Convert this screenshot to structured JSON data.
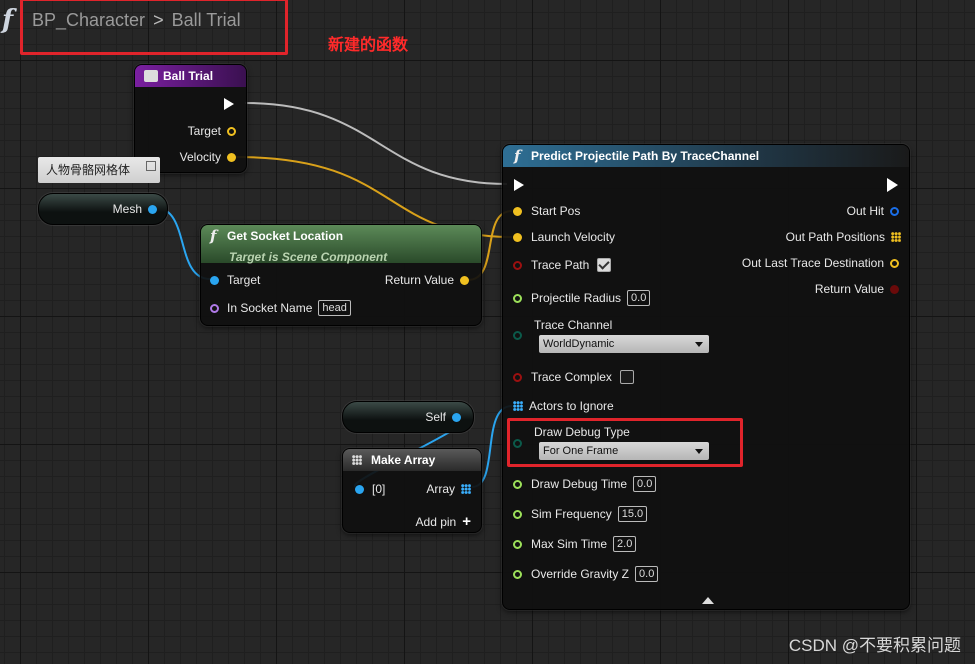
{
  "breadcrumb": {
    "icon": "function-icon",
    "graph": "BP_Character",
    "separator": ">",
    "function": "Ball Trial"
  },
  "annotation": "新建的函数",
  "tooltip": "人物骨骼网格体",
  "nodes": {
    "ball_trial": {
      "title": "Ball Trial",
      "pins": {
        "target": "Target",
        "velocity": "Velocity"
      }
    },
    "mesh_var": {
      "label": "Mesh"
    },
    "get_socket": {
      "title": "Get Socket Location",
      "subtitle": "Target is Scene Component",
      "pins": {
        "target": "Target",
        "socket_name": "In Socket Name",
        "socket_value": "head",
        "return_value": "Return Value"
      }
    },
    "self_var": {
      "label": "Self"
    },
    "make_array": {
      "title": "Make Array",
      "pins": {
        "index0": "[0]",
        "array": "Array",
        "add_pin": "Add pin"
      }
    },
    "predict": {
      "title": "Predict Projectile Path By TraceChannel",
      "inputs": {
        "start_pos": "Start Pos",
        "launch_velocity": "Launch Velocity",
        "trace_path": "Trace Path",
        "projectile_radius": "Projectile Radius",
        "projectile_radius_value": "0.0",
        "trace_channel": "Trace Channel",
        "trace_channel_value": "WorldDynamic",
        "trace_complex": "Trace Complex",
        "actors_to_ignore": "Actors to Ignore",
        "draw_debug_type": "Draw Debug Type",
        "draw_debug_type_value": "For One Frame",
        "draw_debug_time": "Draw Debug Time",
        "draw_debug_time_value": "0.0",
        "sim_frequency": "Sim Frequency",
        "sim_frequency_value": "15.0",
        "max_sim_time": "Max Sim Time",
        "max_sim_time_value": "2.0",
        "override_gravity": "Override Gravity Z",
        "override_gravity_value": "0.0"
      },
      "outputs": {
        "out_hit": "Out Hit",
        "out_path_positions": "Out Path Positions",
        "out_last_trace_destination": "Out Last Trace Destination",
        "return_value": "Return Value"
      },
      "trace_path_checked": true,
      "trace_complex_checked": false
    }
  },
  "colors": {
    "vector_pin": "#f0c020",
    "object_pin": "#2aa5f0",
    "bool_pin": "#9c1010",
    "float_pin": "#9ce05a",
    "name_pin": "#b07ae8",
    "enum_pin": "#0b5a4a",
    "struct_pin": "#1a6ee8",
    "exec_wire": "#bcbcbc",
    "highlight": "#e0242b"
  },
  "watermark": "CSDN @不要积累问题"
}
